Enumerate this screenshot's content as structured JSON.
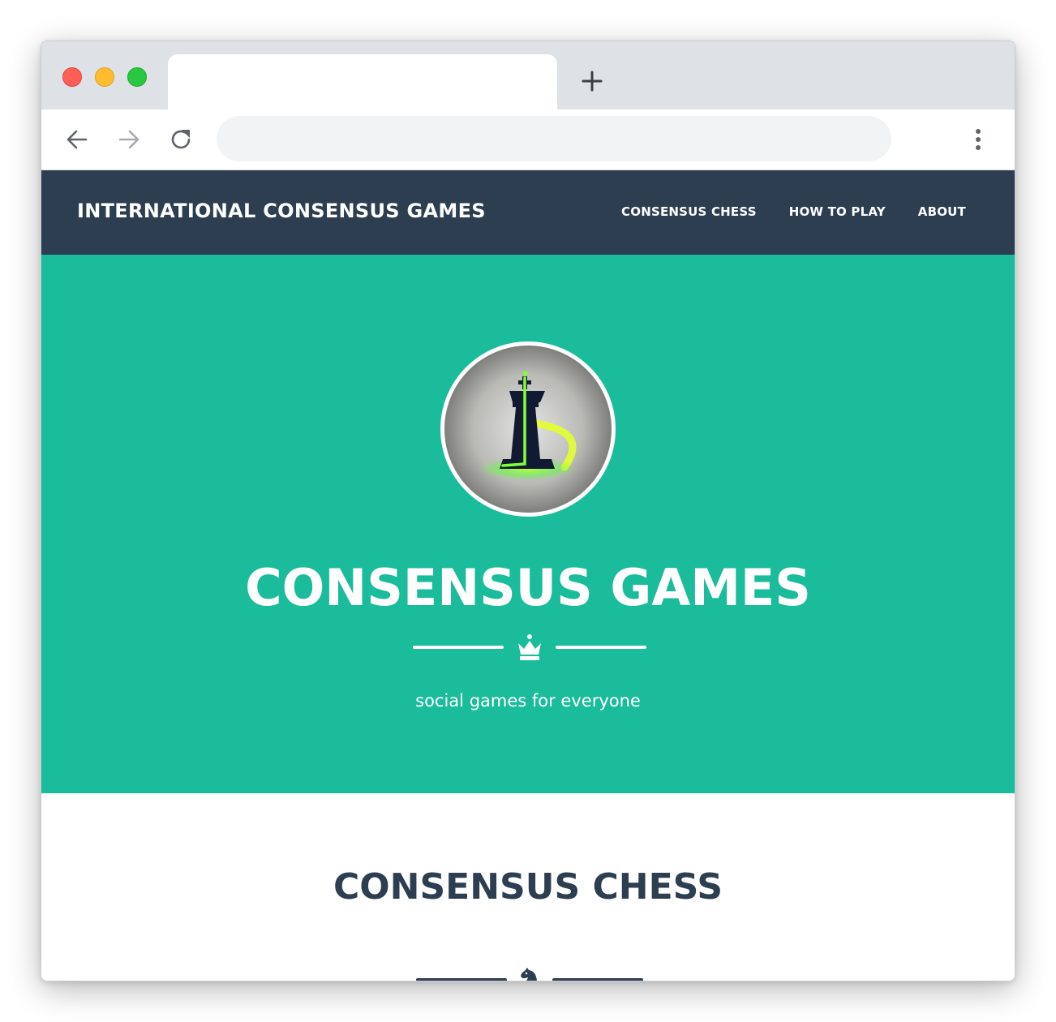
{
  "browser": {
    "tab_title": "",
    "address_placeholder": "",
    "address_value": ""
  },
  "navbar": {
    "brand": "INTERNATIONAL CONSENSUS GAMES",
    "links": [
      {
        "label": "CONSENSUS CHESS"
      },
      {
        "label": "HOW TO PLAY"
      },
      {
        "label": "ABOUT"
      }
    ]
  },
  "hero": {
    "avatar_image": "chess-king-logo",
    "title": "CONSENSUS GAMES",
    "divider_icon": "crown-icon",
    "subtitle": "social games for everyone"
  },
  "section": {
    "title": "CONSENSUS CHESS",
    "divider_icon": "chess-knight-icon"
  },
  "colors": {
    "nav_bg": "#2c3e50",
    "hero_bg": "#1abc9c",
    "text_light": "#ffffff",
    "tab_strip": "#dee1e6",
    "omnibox": "#f1f3f4"
  }
}
